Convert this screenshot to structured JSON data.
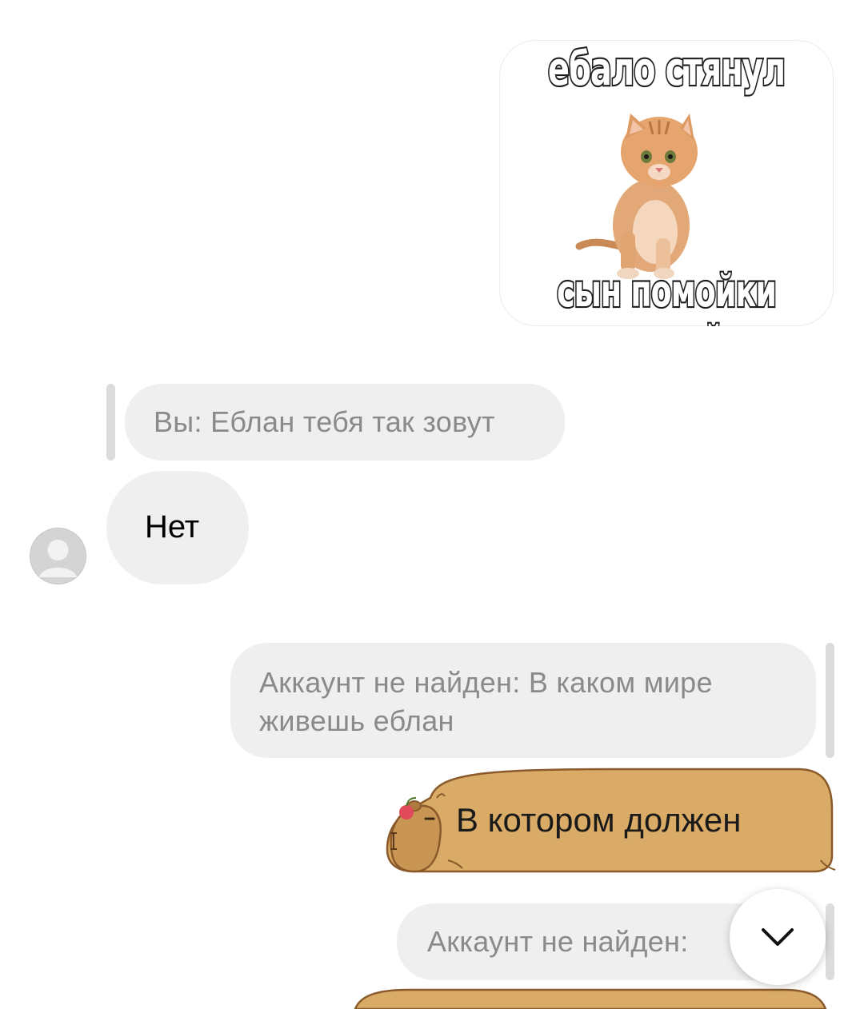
{
  "messages": {
    "sticker": {
      "top_caption": "ебало стянул",
      "bottom_caption": "сын помойки нищей"
    },
    "reply_1": {
      "quoted": "Вы: Еблан тебя так зовут"
    },
    "incoming_1": {
      "text": "Нет"
    },
    "reply_2": {
      "quoted_line1": "Аккаунт не найден: В каком мире",
      "quoted_line2": "живешь еблан"
    },
    "outgoing_capy": {
      "text": "В котором должен"
    },
    "reply_3": {
      "quoted": "Аккаунт не найден:"
    }
  },
  "icons": {
    "avatar": "default-avatar-icon",
    "scroll": "chevron-down-icon"
  },
  "colors": {
    "bubble_gray": "#efefef",
    "quote_text": "#8a8a8a",
    "capybara": "#d9ab66",
    "capybara_outline": "#8a5a2b"
  }
}
